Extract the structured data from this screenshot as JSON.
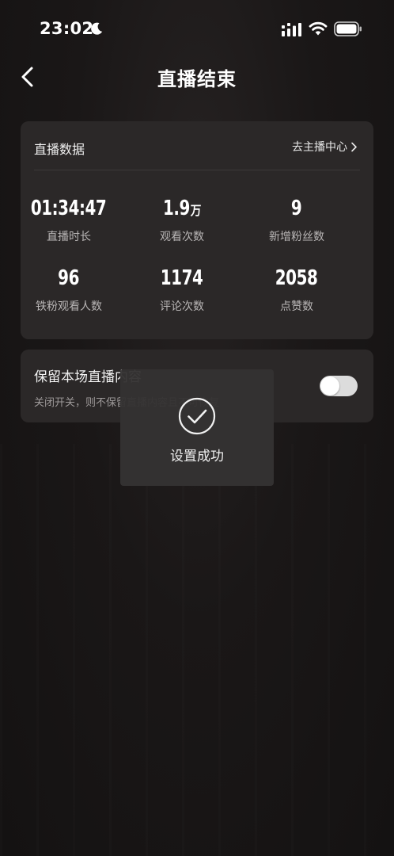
{
  "status_bar": {
    "time": "23:02",
    "icons": [
      "moon-icon",
      "signal-icon",
      "wifi-icon",
      "battery-icon"
    ]
  },
  "nav": {
    "title": "直播结束",
    "back_icon": "back-icon"
  },
  "stats_card": {
    "title": "直播数据",
    "link_label": "去主播中心",
    "stats": [
      {
        "value": "01:34:47",
        "unit": "",
        "label": "直播时长"
      },
      {
        "value": "1.9",
        "unit": "万",
        "label": "观看次数"
      },
      {
        "value": "9",
        "unit": "",
        "label": "新增粉丝数"
      },
      {
        "value": "96",
        "unit": "",
        "label": "铁粉观看人数"
      },
      {
        "value": "1174",
        "unit": "",
        "label": "评论次数"
      },
      {
        "value": "2058",
        "unit": "",
        "label": "点赞数"
      }
    ]
  },
  "retain_card": {
    "title": "保留本场直播内容",
    "description": "关闭开关，则不保留直播内容且不可恢复",
    "toggle_on": false
  },
  "toast": {
    "text": "设置成功",
    "icon": "check-circle-icon"
  },
  "colors": {
    "background": "#151313",
    "card": "#2b2828",
    "toast": "#343232",
    "label": "#b9b6b6"
  }
}
